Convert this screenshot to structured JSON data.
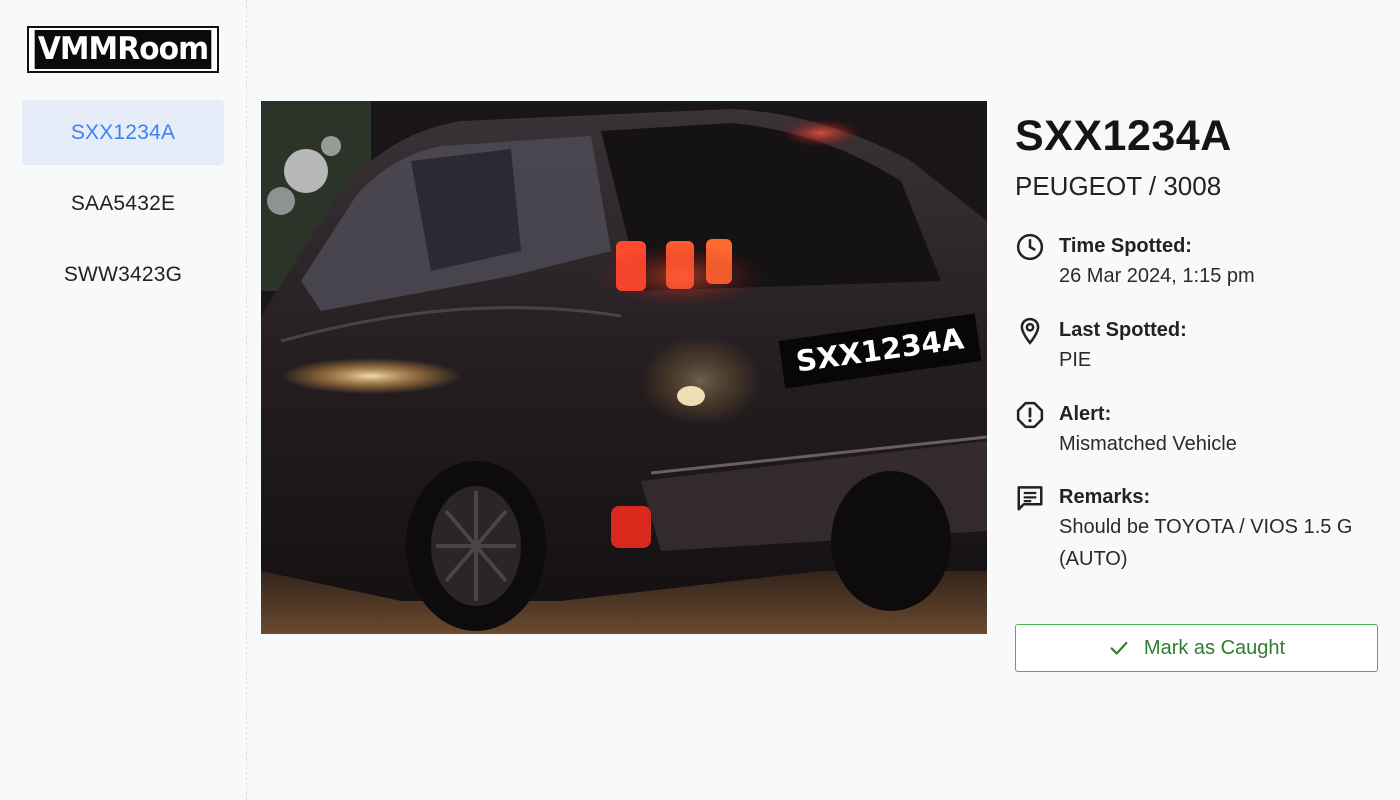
{
  "app": {
    "logo_text": "VMMRoom"
  },
  "sidebar": {
    "items": [
      {
        "label": "SXX1234A",
        "active": true
      },
      {
        "label": "SAA5432E",
        "active": false
      },
      {
        "label": "SWW3423G",
        "active": false
      }
    ]
  },
  "photo": {
    "plate_text": "SXX1234A"
  },
  "details": {
    "plate": "SXX1234A",
    "make_model": "PEUGEOT / 3008",
    "time_spotted": {
      "icon": "clock-icon",
      "label": "Time Spotted:",
      "value": "26 Mar 2024, 1:15 pm"
    },
    "last_spotted": {
      "icon": "location-pin-icon",
      "label": "Last Spotted:",
      "value": "PIE"
    },
    "alert": {
      "icon": "alert-circle-icon",
      "label": "Alert:",
      "value": "Mismatched Vehicle"
    },
    "remarks": {
      "icon": "comment-icon",
      "label": "Remarks:",
      "value": "Should be TOYOTA / VIOS 1.5 G (AUTO)"
    }
  },
  "actions": {
    "mark_caught_label": "Mark as Caught",
    "mark_caught_icon": "check-icon"
  },
  "colors": {
    "accent": "#3b82f6",
    "active_bg": "#e6edf8",
    "success": "#2e7d32",
    "success_border": "#4caf50"
  }
}
